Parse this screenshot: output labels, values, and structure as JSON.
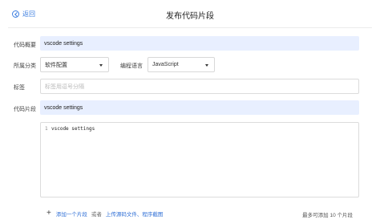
{
  "header": {
    "back_label": "返回",
    "title": "发布代码片段"
  },
  "form": {
    "summary_label": "代码概要",
    "summary_value": "vscode settings",
    "category_label": "所属分类",
    "category_value": "软件配置",
    "language_label": "编程语言",
    "language_value": "JavaScript",
    "tags_label": "标签",
    "tags_placeholder": "标签用逗号分隔",
    "snippet_label": "代码片段",
    "snippet_title": "vscode settings",
    "editor": {
      "line_number": "1",
      "line_text": "vscode settings"
    }
  },
  "footer": {
    "add_snippet": "添加一个片段",
    "or": "或者",
    "upload": "上传源码文件、程序截图",
    "limit_note": "最多可添加 10 个片段"
  },
  "colors": {
    "accent": "#3d7fe0",
    "field_bg": "#e8efff"
  }
}
